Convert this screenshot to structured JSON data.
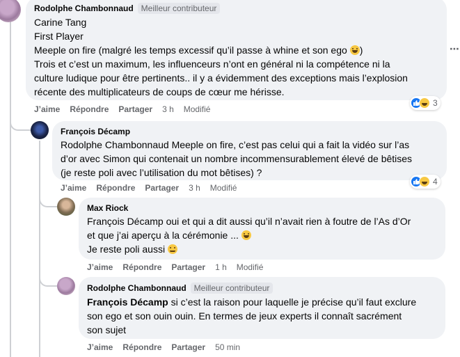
{
  "comments": [
    {
      "author": "Rodolphe Chambonnaud",
      "badge": "Meilleur contributeur",
      "lines": [
        "Carine Tang",
        "First Player",
        "Meeple on fire (malgré les temps excessif qu’il passe à whine et son ego",
        "Trois et c’est un maximum, les influenceurs n’ont en général ni la compétence ni la",
        "culture ludique pour être pertinents.. il y a évidemment des exceptions mais l’explosion",
        "récente des multiplicateurs de coups de cœur me hérisse."
      ],
      "line3_suffix": ")",
      "actions": {
        "like": "J’aime",
        "reply": "Répondre",
        "share": "Partager",
        "time": "3 h",
        "modified": "Modifié"
      },
      "reaction_count": "3"
    },
    {
      "author": "François Décamp",
      "lines": [
        "Rodolphe Chambonnaud Meeple on fire, c’est pas celui qui a fait la vidéo sur l’as",
        "d’or avec Simon qui contenait un nombre incommensurablement élevé de bêtises",
        "(je reste poli avec l’utilisation du mot bêtises) ?"
      ],
      "actions": {
        "like": "J’aime",
        "reply": "Répondre",
        "share": "Partager",
        "time": "3 h",
        "modified": "Modifié"
      },
      "reaction_count": "4"
    },
    {
      "author": "Max Riock",
      "lines": [
        "François Décamp oui et qui a dit aussi qu’il n’avait rien à foutre de l’As d’Or",
        "et que j’ai aperçu à la cérémonie ...",
        "Je reste poli aussi"
      ],
      "actions": {
        "like": "J’aime",
        "reply": "Répondre",
        "share": "Partager",
        "time": "1 h",
        "modified": "Modifié"
      }
    },
    {
      "author": "Rodolphe Chambonnaud",
      "badge": "Meilleur contributeur",
      "mention": "François Décamp",
      "lines": [
        " si c’est la raison pour laquelle je précise qu’il faut exclure",
        "son ego et son ouin ouin. En termes de jeux experts il connaît sacrément",
        "son sujet"
      ],
      "actions": {
        "like": "J’aime",
        "reply": "Répondre",
        "share": "Partager",
        "time": "50 min"
      }
    }
  ],
  "more_options": "⋯",
  "colors": {
    "bubble": "#f0f2f5",
    "like_blue": "#1877f2",
    "meta_gray": "#65676b"
  }
}
